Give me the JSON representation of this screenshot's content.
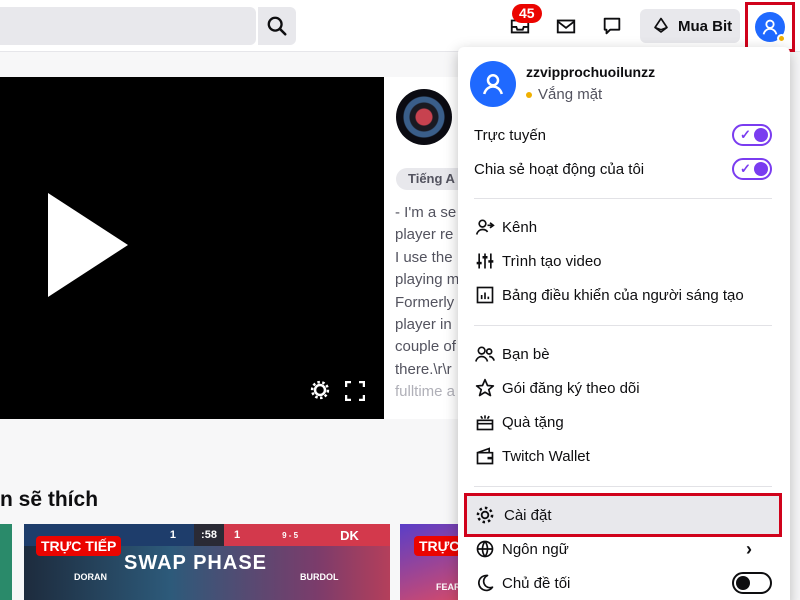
{
  "topbar": {
    "search_placeholder": "",
    "notification_count": "45",
    "buy_bits_label": "Mua Bit"
  },
  "stream": {
    "language_tag": "Tiếng A",
    "description_lines": [
      "- I'm a se",
      "player re",
      "I use the",
      "playing m",
      "Formerly",
      "player in",
      "couple of",
      "there.\\r\\r",
      "fulltime a"
    ]
  },
  "section": {
    "title": "n sẽ thích"
  },
  "thumbnails": {
    "live_label": "TRỰC TIẾP",
    "live_label_2": "TRỰC",
    "game_title": "SWAP PHASE",
    "team_left": "1",
    "team_right": "DK",
    "score_right": "1",
    "time": ":58",
    "score_mid": "9 - 5",
    "player_left": "DORAN",
    "player_right": "BURDOL",
    "player_far": "FEARN"
  },
  "menu": {
    "username": "zzvipprochuoilunzz",
    "status": "Vắng mặt",
    "toggles": [
      {
        "label": "Trực tuyến",
        "on": true
      },
      {
        "label": "Chia sẻ hoạt động của tôi",
        "on": true
      }
    ],
    "group1": [
      {
        "label": "Kênh",
        "icon": "channel-icon"
      },
      {
        "label": "Trình tạo video",
        "icon": "sliders-icon"
      },
      {
        "label": "Bảng điều khiển của người sáng tạo",
        "icon": "dashboard-icon"
      }
    ],
    "group2": [
      {
        "label": "Bạn bè",
        "icon": "friends-icon"
      },
      {
        "label": "Gói đăng ký theo dõi",
        "icon": "star-icon"
      },
      {
        "label": "Quà tặng",
        "icon": "gift-icon"
      },
      {
        "label": "Twitch Wallet",
        "icon": "wallet-icon"
      }
    ],
    "settings_label": "Cài đặt",
    "language_label": "Ngôn ngữ",
    "dark_theme_label": "Chủ đề tối",
    "dark_theme_on": false
  },
  "colors": {
    "accent": "#7a3cf0",
    "avatar": "#1f69ff",
    "live": "#eb0400",
    "highlight": "#d0021b"
  }
}
